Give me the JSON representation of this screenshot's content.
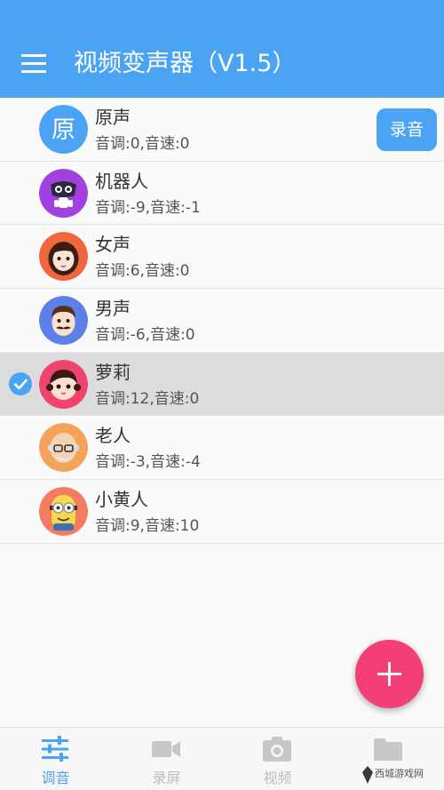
{
  "app": {
    "title": "视频变声器（V1.5）"
  },
  "colors": {
    "primary": "#4aa4f3",
    "accent": "#f33f76",
    "selected_row": "#dcdcdc"
  },
  "toolbar": {
    "menu_icon": "menu-icon"
  },
  "voices": [
    {
      "name": "原声",
      "params": "音调:0,音速:0",
      "avatar": "text-avatar",
      "avatar_text": "原",
      "selected": false
    },
    {
      "name": "机器人",
      "params": "音调:-9,音速:-1",
      "avatar": "robot-avatar",
      "selected": false
    },
    {
      "name": "女声",
      "params": "音调:6,音速:0",
      "avatar": "woman-avatar",
      "selected": false
    },
    {
      "name": "男声",
      "params": "音调:-6,音速:0",
      "avatar": "man-avatar",
      "selected": false
    },
    {
      "name": "萝莉",
      "params": "音调:12,音速:0",
      "avatar": "girl-avatar",
      "selected": true
    },
    {
      "name": "老人",
      "params": "音调:-3,音速:-4",
      "avatar": "old-man-avatar",
      "selected": false
    },
    {
      "name": "小黄人",
      "params": "音调:9,音速:10",
      "avatar": "minion-avatar",
      "selected": false
    }
  ],
  "record_button": {
    "label": "录音"
  },
  "fab": {
    "icon": "plus-icon"
  },
  "bottom_nav": [
    {
      "label": "调音",
      "icon": "sliders-icon",
      "active": true
    },
    {
      "label": "录屏",
      "icon": "video-camera-icon",
      "active": false
    },
    {
      "label": "视频",
      "icon": "camera-icon",
      "active": false
    },
    {
      "label": "",
      "icon": "folder-icon",
      "active": false
    }
  ],
  "watermark": {
    "text": "西城游戏网"
  }
}
